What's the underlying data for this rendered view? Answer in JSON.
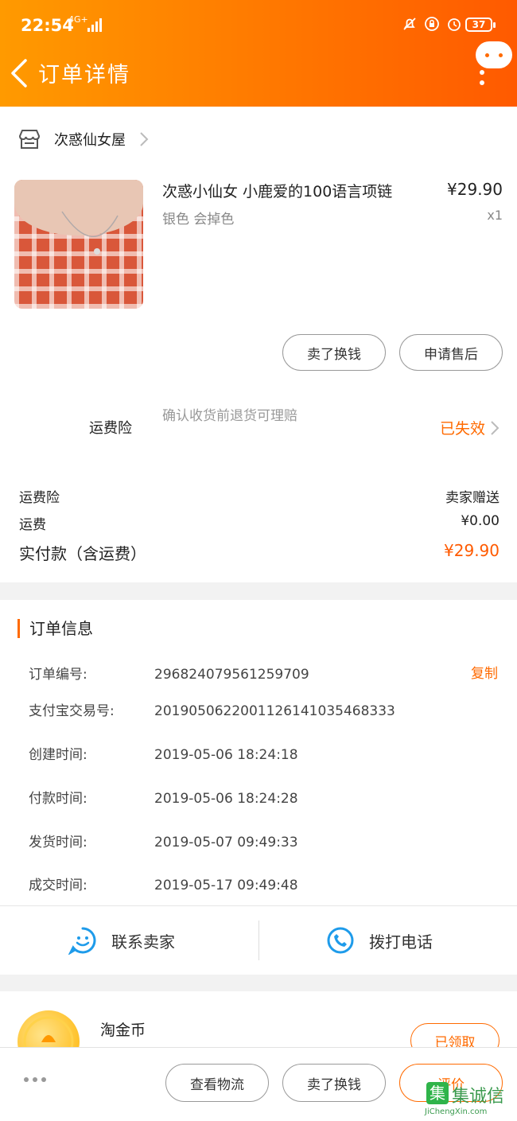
{
  "status_bar": {
    "time": "22:54",
    "network": "4G+",
    "battery": "37"
  },
  "header": {
    "title": "订单详情"
  },
  "shop": {
    "name": "次惑仙女屋"
  },
  "product": {
    "name": "次惑小仙女 小鹿爱的100语言项链",
    "price": "¥29.90",
    "spec": "银色 会掉色",
    "qty": "x1",
    "actions": [
      "卖了换钱",
      "申请售后"
    ]
  },
  "insurance": {
    "label": "运费险",
    "desc": "确认收货前退货可理赔",
    "status": "已失效"
  },
  "fees": [
    {
      "label": "运费险",
      "value": "卖家赠送"
    },
    {
      "label": "运费",
      "value": "¥0.00"
    },
    {
      "label": "实付款（含运费）",
      "value": "¥29.90"
    }
  ],
  "order_info": {
    "title": "订单信息",
    "copy_label": "复制",
    "rows": [
      {
        "label": "订单编号:",
        "value": "296824079561259709"
      },
      {
        "label": "支付宝交易号:",
        "value": "2019050622001126141035468333"
      },
      {
        "label": "创建时间:",
        "value": "2019-05-06 18:24:18"
      },
      {
        "label": "付款时间:",
        "value": "2019-05-06 18:24:28"
      },
      {
        "label": "发货时间:",
        "value": "2019-05-07 09:49:33"
      },
      {
        "label": "成交时间:",
        "value": "2019-05-17 09:49:48"
      }
    ]
  },
  "contact": {
    "seller": "联系卖家",
    "call": "拨打电话"
  },
  "coin": {
    "label": "淘金币",
    "status": "已领取"
  },
  "bottom_bar": {
    "logistics": "查看物流",
    "resell": "卖了换钱",
    "review": "评价"
  },
  "watermark": {
    "text": "JiChengXin.com",
    "brand": "集诚信"
  },
  "colors": {
    "accent": "#ff6a00",
    "header_start": "#ff9a00",
    "header_end": "#ff5a00"
  }
}
